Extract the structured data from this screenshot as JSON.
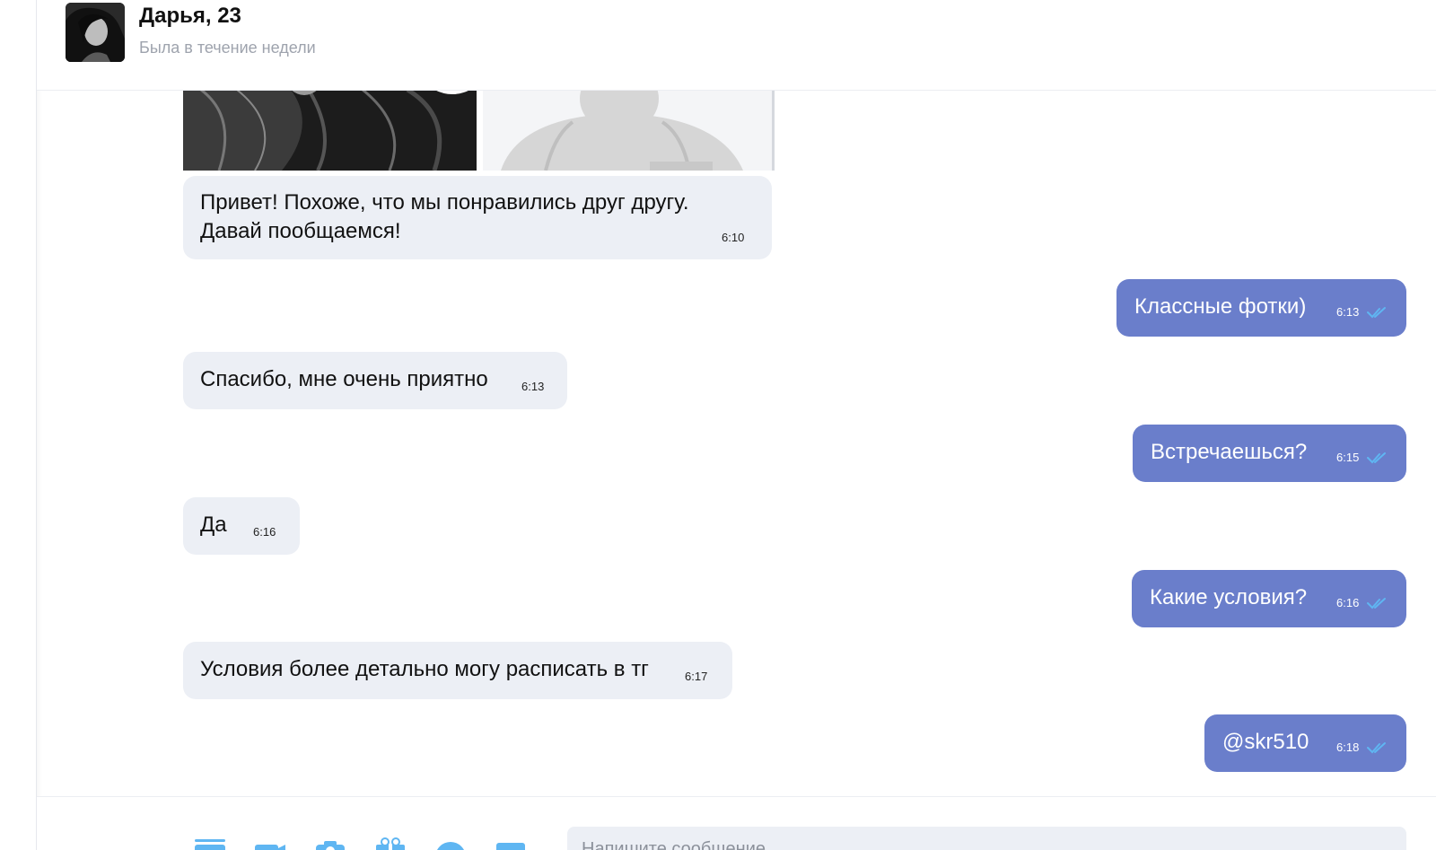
{
  "header": {
    "name": "Дарья, 23",
    "status": "Была в течение недели"
  },
  "messages": [
    {
      "direction": "in",
      "text": "Привет! Похоже, что мы понравились друг другу.\nДавай пообщаемся!",
      "time": "6:10"
    },
    {
      "direction": "out",
      "text": "Классные фотки)",
      "time": "6:13",
      "read": true
    },
    {
      "direction": "in",
      "text": "Спасибо, мне очень приятно",
      "time": "6:13"
    },
    {
      "direction": "out",
      "text": "Встречаешься?",
      "time": "6:15",
      "read": true
    },
    {
      "direction": "in",
      "text": "Да",
      "time": "6:16"
    },
    {
      "direction": "out",
      "text": "Какие условия?",
      "time": "6:16",
      "read": true
    },
    {
      "direction": "in",
      "text": "Условия более детально могу расписать в тг",
      "time": "6:17"
    },
    {
      "direction": "out",
      "text": "@skr510",
      "time": "6:18",
      "read": true
    }
  ],
  "composer": {
    "placeholder": "Напишите сообщение...",
    "tools": [
      "cards-icon",
      "video-icon",
      "camera-icon",
      "gift-icon",
      "sticker-icon",
      "image-icon"
    ]
  },
  "colors": {
    "outgoing_bubble": "#6a7ecb",
    "incoming_bubble": "#eceff5",
    "read_check": "#5fb6f2",
    "status_text": "#9ea3ad"
  }
}
